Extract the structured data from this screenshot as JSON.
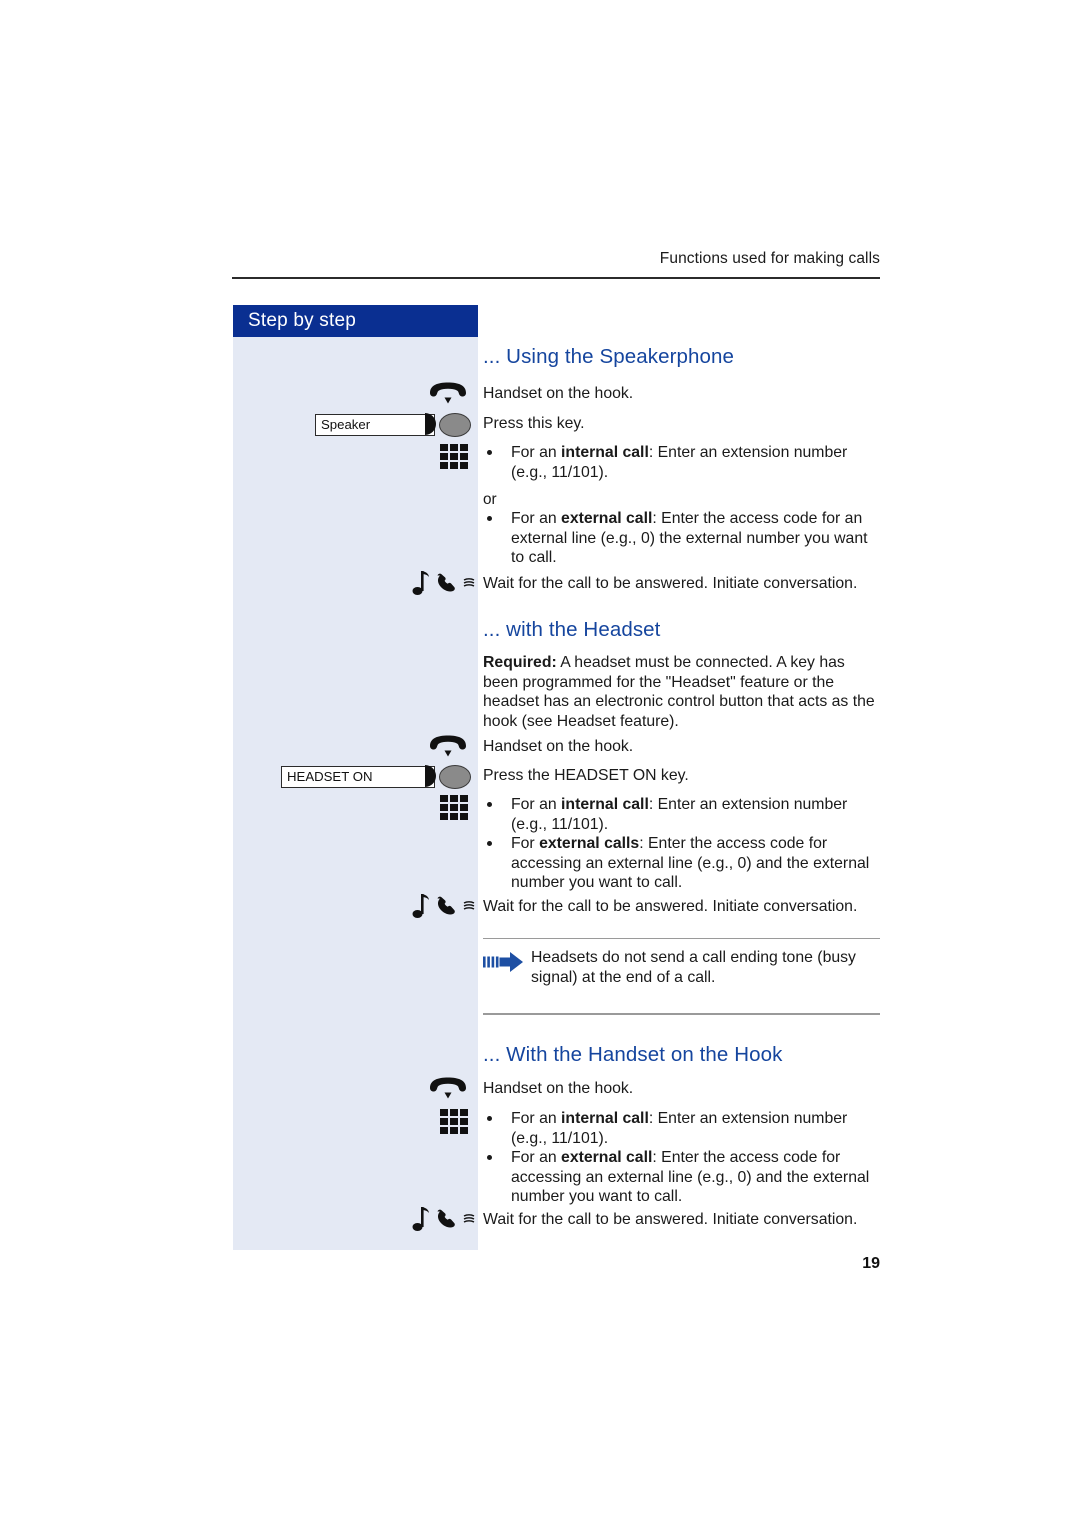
{
  "page": {
    "running_head": "Functions used for making calls",
    "page_number": "19",
    "colors": {
      "sidebar_header_bg": "#0a2f91",
      "sidebar_bg": "#e4e9f4",
      "heading_blue": "#15459e",
      "note_arrow_blue": "#1d4fa3",
      "key_button_gray": "#8a8a8a"
    }
  },
  "sidebar": {
    "title": "Step by step"
  },
  "sections": [
    {
      "heading": "... Using the Speakerphone",
      "steps": [
        {
          "icon": "handset-on-hook-icon",
          "text": "Handset on the hook."
        },
        {
          "icon": "speaker-key-icon",
          "key_label": "Speaker",
          "text": "Press this key."
        },
        {
          "icon": "keypad-icon",
          "bullets": [
            {
              "prefix": "For an ",
              "bold": "internal call",
              "suffix": ": Enter an extension number (e.g., 11/101)."
            }
          ]
        },
        {
          "or_label": "or",
          "bullets": [
            {
              "prefix": "For an ",
              "bold": "external call",
              "suffix": ": Enter the access code for an external line (e.g.,  0) the external number you want to call."
            }
          ]
        },
        {
          "icon": "ringing-handset-icon",
          "text": "Wait for the call to be answered. Initiate conversation."
        }
      ]
    },
    {
      "heading": "... with the Headset",
      "required_label": "Required:",
      "required_text": " A headset must be connected. A key has been programmed for the \"Headset\" feature or the headset has an electronic control button that acts as the hook (see Headset feature).",
      "steps": [
        {
          "icon": "handset-on-hook-icon",
          "text": "Handset on the hook."
        },
        {
          "icon": "headset-on-key-icon",
          "key_label": "HEADSET ON",
          "text": "Press the HEADSET ON key."
        },
        {
          "icon": "keypad-icon",
          "bullets": [
            {
              "prefix": "For an ",
              "bold": "internal call",
              "suffix": ": Enter an extension number (e.g., 11/101)."
            },
            {
              "prefix": "For ",
              "bold": "external calls",
              "suffix": ": Enter the access code for accessing an external line (e.g., 0) and the external number you want to call."
            }
          ]
        },
        {
          "icon": "ringing-handset-icon",
          "text": "Wait for the call to be answered. Initiate conversation."
        }
      ],
      "note": {
        "icon": "note-arrow-icon",
        "text": "Headsets do not send a call ending tone (busy signal) at the end of a call."
      }
    },
    {
      "heading": "... With the Handset on the Hook",
      "steps": [
        {
          "icon": "handset-on-hook-icon",
          "text": "Handset on the hook."
        },
        {
          "icon": "keypad-icon",
          "bullets": [
            {
              "prefix": "For an ",
              "bold": "internal call",
              "suffix": ": Enter an extension number (e.g., 11/101)."
            },
            {
              "prefix": "For an ",
              "bold": "external call",
              "suffix": ": Enter the access code for accessing an external line (e.g., 0) and the external number you want to call."
            }
          ]
        },
        {
          "icon": "ringing-handset-icon",
          "text": "Wait for the call to be answered. Initiate conversation."
        }
      ]
    }
  ]
}
